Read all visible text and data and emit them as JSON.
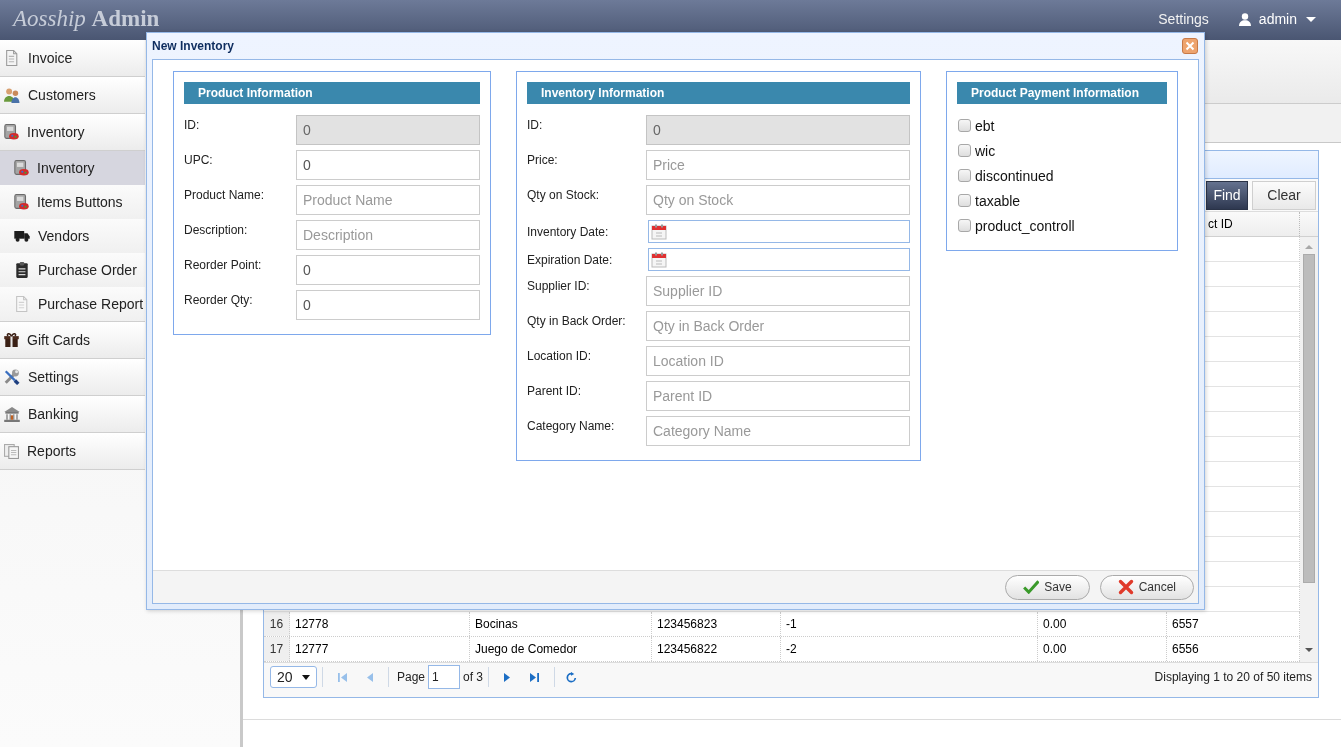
{
  "header": {
    "logo": "*Aosship* **Admin**",
    "settings_link": "Settings",
    "user": "admin"
  },
  "sidebar": {
    "items": [
      {
        "label": "Invoice",
        "selected": false
      },
      {
        "label": "Customers",
        "selected": false
      },
      {
        "label": "Inventory",
        "selected": false,
        "children": [
          {
            "label": "Inventory",
            "selected": true
          },
          {
            "label": "Items Buttons",
            "selected": false
          },
          {
            "label": "Vendors",
            "selected": false
          },
          {
            "label": "Purchase Order",
            "selected": false
          },
          {
            "label": "Purchase Report",
            "selected": false
          }
        ]
      },
      {
        "label": "Gift Cards",
        "selected": false
      },
      {
        "label": "Settings",
        "selected": false
      },
      {
        "label": "Banking",
        "selected": false
      },
      {
        "label": "Reports",
        "selected": false
      }
    ]
  },
  "grid": {
    "toolbar_buttons": [
      {
        "label": "Find",
        "kind": "primary"
      },
      {
        "label": "Clear",
        "kind": "default"
      }
    ],
    "columns": [
      "ct ID"
    ],
    "rows": [
      {
        "number": "16",
        "cells": [
          "12778",
          "Bocinas",
          "123456823",
          "-1",
          "0.00",
          "6557"
        ]
      },
      {
        "number": "17",
        "cells": [
          "12777",
          "Juego de Comedor",
          "123456822",
          "-2",
          "0.00",
          "6556"
        ]
      }
    ],
    "pager": {
      "page_size": "20",
      "buttons": [
        {
          "disabled": true
        },
        {
          "disabled": true
        },
        {
          "disabled": false
        },
        {
          "disabled": false
        }
      ],
      "page_label": "Page",
      "page": "1",
      "page_total": "of 3",
      "summary": "Displaying 1 to 20 of 50 items"
    }
  },
  "dialog": {
    "title": "New Inventory",
    "sections": [
      {
        "kind": "fields",
        "title": "Product Information",
        "fields": [
          {
            "label": "ID:",
            "kind": "text",
            "value": "0",
            "disabled": true
          },
          {
            "label": "UPC:",
            "kind": "text",
            "value": "0",
            "disabled": false
          },
          {
            "label": "Product Name:",
            "kind": "text",
            "placeholder": "Product Name",
            "disabled": false
          },
          {
            "label": "Description:",
            "kind": "text",
            "placeholder": "Description",
            "disabled": false
          },
          {
            "label": "Reorder Point:",
            "kind": "text",
            "value": "0",
            "disabled": false
          },
          {
            "label": "Reorder Qty:",
            "kind": "text",
            "value": "0",
            "disabled": false
          }
        ]
      },
      {
        "kind": "fields",
        "title": "Inventory Information",
        "fields": [
          {
            "label": "ID:",
            "kind": "text",
            "value": "0",
            "disabled": true
          },
          {
            "label": "Price:",
            "kind": "text",
            "placeholder": "Price",
            "disabled": false
          },
          {
            "label": "Qty on Stock:",
            "kind": "text",
            "placeholder": "Qty on Stock",
            "disabled": false
          },
          {
            "label": "Inventory Date:",
            "kind": "date"
          },
          {
            "label": "Expiration Date:",
            "kind": "date"
          },
          {
            "label": "Supplier ID:",
            "kind": "text",
            "placeholder": "Supplier ID",
            "disabled": false
          },
          {
            "label": "Qty in Back Order:",
            "kind": "text",
            "placeholder": "Qty in Back Order",
            "disabled": false
          },
          {
            "label": "Location ID:",
            "kind": "text",
            "placeholder": "Location ID",
            "disabled": false
          },
          {
            "label": "Parent ID:",
            "kind": "text",
            "placeholder": "Parent ID",
            "disabled": false
          },
          {
            "label": "Category Name:",
            "kind": "text",
            "placeholder": "Category Name",
            "disabled": false
          }
        ]
      },
      {
        "kind": "checkboxes",
        "title": "Product Payment Information",
        "options": [
          {
            "label": "ebt",
            "checked": false
          },
          {
            "label": "wic",
            "checked": false
          },
          {
            "label": "discontinued",
            "checked": false
          },
          {
            "label": "taxable",
            "checked": false
          },
          {
            "label": "product_controll",
            "checked": false
          }
        ]
      }
    ],
    "buttons": [
      {
        "label": "Save",
        "kind": "save"
      },
      {
        "label": "Cancel",
        "kind": "cancel"
      }
    ]
  }
}
